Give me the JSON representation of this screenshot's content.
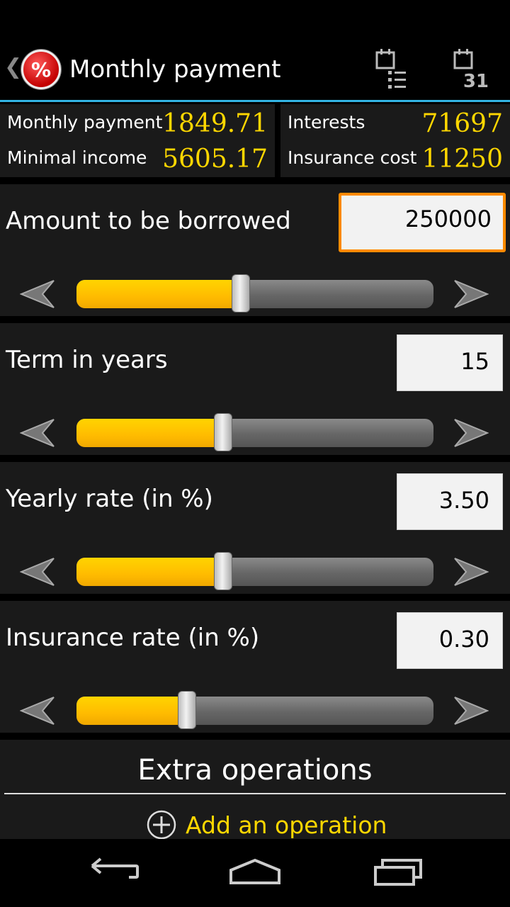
{
  "action_bar": {
    "title": "Monthly payment",
    "app_icon_symbol": "%",
    "back_icon": "chevron-left-icon",
    "list_button_icon": "calendar-list-icon",
    "calendar_button_icon": "calendar-icon",
    "calendar_number": "31",
    "accent_color": "#33b5e5"
  },
  "summary": {
    "monthly_payment_label": "Monthly payment",
    "monthly_payment_value": "1849.71",
    "minimal_income_label": "Minimal income",
    "minimal_income_value": "5605.17",
    "interests_label": "Interests",
    "interests_value": "71697",
    "insurance_cost_label": "Insurance cost",
    "insurance_cost_value": "11250",
    "value_color": "#ffd700"
  },
  "sections": [
    {
      "label": "Amount to be borrowed",
      "value": "250000",
      "focused": true,
      "slider_fraction": 0.46
    },
    {
      "label": "Term in years",
      "value": "15",
      "focused": false,
      "slider_fraction": 0.41
    },
    {
      "label": "Yearly rate (in %)",
      "value": "3.50",
      "focused": false,
      "slider_fraction": 0.41
    },
    {
      "label": "Insurance rate (in %)",
      "value": "0.30",
      "focused": false,
      "slider_fraction": 0.31
    }
  ],
  "extra": {
    "title": "Extra operations",
    "add_label": "Add an operation",
    "add_icon": "plus-circle-icon"
  },
  "nav": {
    "back_icon": "back-icon",
    "home_icon": "home-icon",
    "recents_icon": "recents-icon"
  }
}
